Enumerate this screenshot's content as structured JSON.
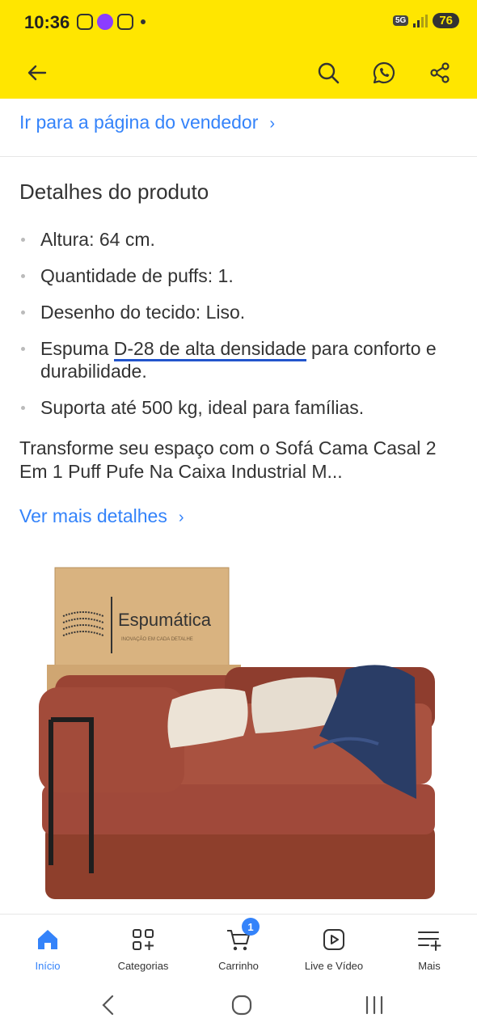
{
  "status_bar": {
    "time": "10:36",
    "network": "5G",
    "battery": "76"
  },
  "top_bar": {
    "back_icon": "arrow-left-icon",
    "search_icon": "search-icon",
    "whatsapp_icon": "whatsapp-icon",
    "share_icon": "share-icon"
  },
  "seller_link": {
    "label": "Ir para a página do vendedor",
    "chevron": "›"
  },
  "details": {
    "title": "Detalhes do produto",
    "bullets": [
      {
        "text": "Altura: 64 cm."
      },
      {
        "text": "Quantidade de puffs: 1."
      },
      {
        "text": "Desenho do tecido: Liso."
      },
      {
        "prefix": "Espuma ",
        "highlight": "D-28 de alta densidade",
        "suffix": " para conforto e durabilidade."
      },
      {
        "text": "Suporta até 500 kg, ideal para famílias."
      }
    ],
    "description": "Transforme seu espaço com o Sofá Cama Casal 2 Em 1 Puff Pufe Na Caixa Industrial M...",
    "more_link": "Ver mais detalhes",
    "more_chevron": "›"
  },
  "product_image": {
    "box_brand": "Espumática",
    "box_tagline": "INOVAÇÃO EM CADA DETALHE"
  },
  "bottom_nav": {
    "items": [
      {
        "label": "Início",
        "icon": "home-icon",
        "active": true
      },
      {
        "label": "Categorias",
        "icon": "categories-icon",
        "active": false
      },
      {
        "label": "Carrinho",
        "icon": "cart-icon",
        "badge": "1",
        "active": false
      },
      {
        "label": "Live e Vídeo",
        "icon": "video-play-icon",
        "active": false
      },
      {
        "label": "Mais",
        "icon": "menu-plus-icon",
        "active": false
      }
    ]
  },
  "colors": {
    "header_bg": "#ffe600",
    "link": "#3483fa",
    "text": "#333333",
    "highlight_underline": "#2255cc"
  }
}
